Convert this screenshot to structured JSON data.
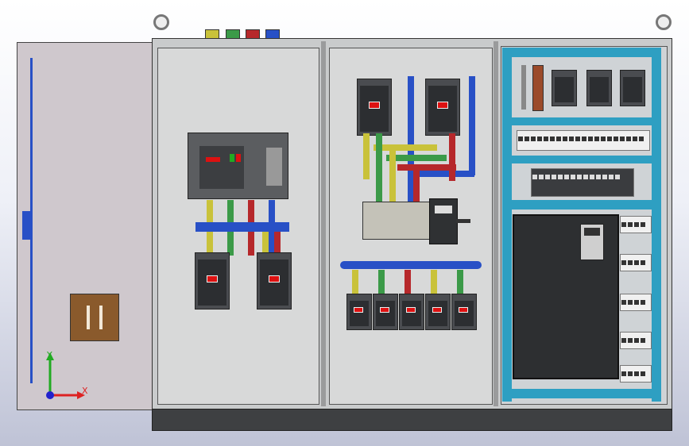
{
  "axes": {
    "x_label": "X",
    "y_label": "Y"
  },
  "colors": {
    "yellow": "#c9c23a",
    "green": "#3b9a48",
    "red": "#b6282b",
    "blue": "#2850c6",
    "teal": "#2e9fc2"
  },
  "icons": [
    "lifting-eye-icon",
    "axis-triad-icon"
  ]
}
